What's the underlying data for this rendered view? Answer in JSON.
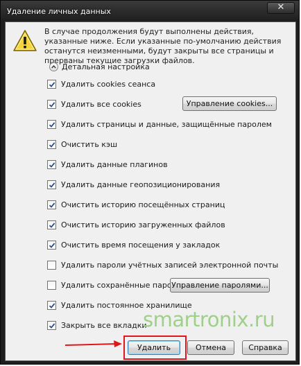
{
  "window": {
    "title": "Удаление личных данных",
    "close_icon": "x-icon"
  },
  "message": "В случае продолжения будут выполнены действия, указанные ниже. Если указанные по-умолчанию действия останутся неизменными, будут закрыты все страницы и прерваны текущие загрузки файлов.",
  "details_label": "Детальная настройка",
  "options": [
    {
      "label": "Удалить cookies сеанса",
      "checked": true
    },
    {
      "label": "Удалить все cookies",
      "checked": true
    },
    {
      "label": "Удалить страницы и данные, защищённые паролем",
      "checked": true
    },
    {
      "label": "Очистить кэш",
      "checked": true
    },
    {
      "label": "Удалить данные плагинов",
      "checked": true
    },
    {
      "label": "Удалить данные геопозиционирования",
      "checked": true
    },
    {
      "label": "Очистить историю посещённых страниц",
      "checked": true
    },
    {
      "label": "Очистить историю загруженных файлов",
      "checked": true
    },
    {
      "label": "Очистить время посещения у закладок",
      "checked": true
    },
    {
      "label": "Удалить пароли учётных записей электронной почты",
      "checked": false
    },
    {
      "label": "Удалить сохранённые пароли",
      "checked": false
    },
    {
      "label": "Удалить постоянное хранилище",
      "checked": true
    },
    {
      "label": "Закрыть все вкладки",
      "checked": true
    }
  ],
  "buttons": {
    "manage_cookies": "Управление cookies...",
    "manage_passwords": "Управление паролями...",
    "delete": "Удалить",
    "cancel": "Отмена",
    "help": "Справка"
  },
  "watermark": "smartronix.ru",
  "colors": {
    "highlight": "#e0161b",
    "watermark": "#9fd089",
    "titlebar": "#1e1e1e"
  }
}
